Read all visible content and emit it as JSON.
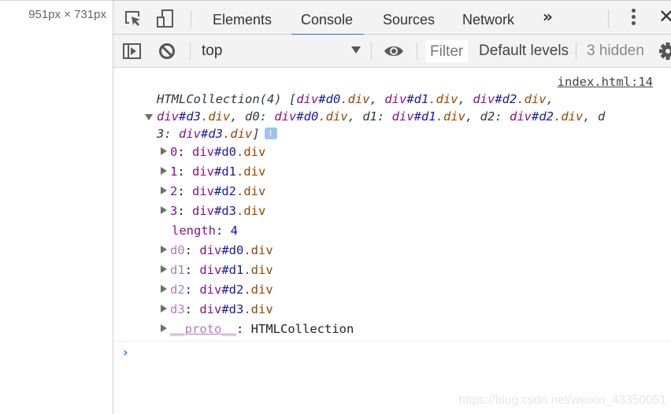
{
  "viewport_dims": "951px × 731px",
  "tabbar": {
    "icons": [
      "inspect-element-icon",
      "device-toolbar-icon"
    ],
    "tabs": [
      {
        "label": "Elements",
        "active": false
      },
      {
        "label": "Console",
        "active": true
      },
      {
        "label": "Sources",
        "active": false
      },
      {
        "label": "Network",
        "active": false
      }
    ],
    "more_tabs": "»",
    "menu_icon": "kebab-menu-icon",
    "close": "✕"
  },
  "toolbar": {
    "context": "top",
    "filter_placeholder": "Filter",
    "levels": "Default levels",
    "hidden": "3 hidden"
  },
  "console": {
    "source_link": "index.html:14",
    "log": {
      "summary_prefix": "HTMLCollection(4) [",
      "summary_items": [
        {
          "tag": "div",
          "id": "#d0",
          "cls": ".div"
        },
        {
          "tag": "div",
          "id": "#d1",
          "cls": ".div"
        },
        {
          "tag": "div",
          "id": "#d2",
          "cls": ".div"
        },
        {
          "tag": "div",
          "id": "#d3",
          "cls": ".div"
        }
      ],
      "info_badge": "i",
      "indexed": [
        {
          "key": "0",
          "tag": "div",
          "id": "#d0",
          "cls": ".div"
        },
        {
          "key": "1",
          "tag": "div",
          "id": "#d1",
          "cls": ".div"
        },
        {
          "key": "2",
          "tag": "div",
          "id": "#d2",
          "cls": ".div"
        },
        {
          "key": "3",
          "tag": "div",
          "id": "#d3",
          "cls": ".div"
        }
      ],
      "length_key": "length",
      "length_value": "4",
      "named": [
        {
          "key": "d0",
          "tag": "div",
          "id": "#d0",
          "cls": ".div"
        },
        {
          "key": "d1",
          "tag": "div",
          "id": "#d1",
          "cls": ".div"
        },
        {
          "key": "d2",
          "tag": "div",
          "id": "#d2",
          "cls": ".div"
        },
        {
          "key": "d3",
          "tag": "div",
          "id": "#d3",
          "cls": ".div"
        }
      ],
      "proto_key": "__proto__",
      "proto_value": "HTMLCollection"
    },
    "prompt": "›"
  },
  "watermark": "https://blog.csdn.net/weixin_43350051",
  "colors": {
    "accent": "#1a73e8",
    "tag": "#881280",
    "id": "#1a1aa6",
    "class": "#994500",
    "prompt": "#367cf1"
  }
}
